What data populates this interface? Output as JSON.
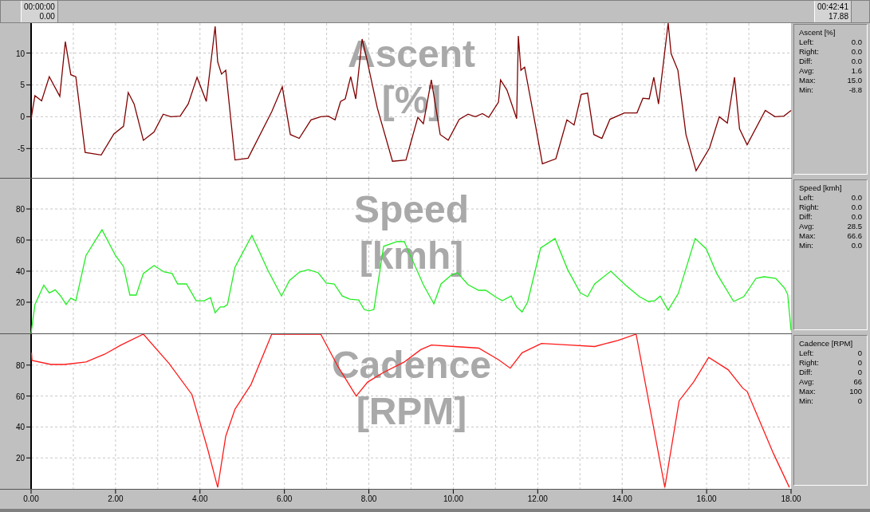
{
  "range_bar": {
    "start": {
      "time": "00:00:00",
      "distance": "0.00"
    },
    "end": {
      "time": "00:42:41",
      "distance": "17.88"
    }
  },
  "panels": [
    {
      "stats": {
        "title": "Ascent [%]",
        "rows": [
          {
            "label": "Left:",
            "value": "0.0"
          },
          {
            "label": "Right:",
            "value": "0.0"
          },
          {
            "label": "Diff:",
            "value": "0.0"
          },
          {
            "label": "Avg:",
            "value": "1.6"
          },
          {
            "label": "Max:",
            "value": "15.0"
          },
          {
            "label": "Min:",
            "value": "-8.8"
          }
        ]
      },
      "chart_data": {
        "type": "line",
        "grid": true,
        "title": "Ascent [%]",
        "xlim": [
          0,
          18
        ],
        "ylim": [
          -9.6,
          14.7
        ],
        "yticks": [
          -5,
          0,
          5,
          10
        ],
        "x": [
          0,
          0.09,
          0.25,
          0.43,
          0.68,
          0.81,
          0.94,
          1.06,
          1.28,
          1.66,
          1.96,
          2.19,
          2.3,
          2.44,
          2.66,
          2.91,
          3.13,
          3.31,
          3.53,
          3.72,
          3.93,
          4.15,
          4.36,
          4.42,
          4.51,
          4.61,
          4.83,
          5.14,
          5.7,
          5.95,
          6.14,
          6.35,
          6.63,
          6.86,
          7.04,
          7.2,
          7.33,
          7.44,
          7.57,
          7.69,
          7.84,
          7.95,
          8.2,
          8.56,
          8.88,
          9.16,
          9.29,
          9.48,
          9.69,
          9.88,
          10.14,
          10.35,
          10.52,
          10.69,
          10.84,
          11.07,
          11.12,
          11.27,
          11.5,
          11.54,
          11.6,
          11.69,
          11.95,
          12.11,
          12.43,
          12.69,
          12.86,
          13.03,
          13.18,
          13.33,
          13.52,
          13.71,
          14.05,
          14.35,
          14.49,
          14.64,
          14.75,
          14.86,
          15.09,
          15.16,
          15.32,
          15.51,
          15.75,
          16.07,
          16.3,
          16.49,
          16.66,
          16.78,
          16.96,
          17.39,
          17.62,
          17.83,
          18
        ],
        "series": [
          {
            "color": "#800000",
            "values": [
              -0.3,
              3.3,
              2.5,
              6.3,
              3.2,
              11.8,
              6.6,
              6.3,
              -5.6,
              -6,
              -2.7,
              -1.5,
              3.8,
              2,
              -3.7,
              -2.4,
              0.4,
              0,
              0.1,
              2,
              6.2,
              2.4,
              14.2,
              8.6,
              6.7,
              7.3,
              -6.8,
              -6.5,
              0.8,
              4.7,
              -2.8,
              -3.4,
              -0.5,
              0,
              0.1,
              -0.5,
              2.4,
              2.8,
              6.3,
              2.8,
              12.2,
              9.1,
              1.4,
              -7,
              -6.8,
              -0.1,
              -1.1,
              5.8,
              -2.8,
              -3.7,
              -0.4,
              0.4,
              0,
              0.5,
              -0.1,
              2.3,
              5.8,
              4.2,
              -0.3,
              12.7,
              7.3,
              7.8,
              -1.5,
              -7.4,
              -6.6,
              -0.5,
              -1.3,
              3.5,
              3.7,
              -2.8,
              -3.4,
              -0.4,
              0.6,
              0.6,
              2.9,
              2.8,
              6.2,
              2,
              14.7,
              9.9,
              7.3,
              -2.8,
              -8.5,
              -4.9,
              0,
              -1,
              6.2,
              -1.9,
              -4.4,
              1,
              0,
              0.1,
              1
            ]
          }
        ]
      }
    },
    {
      "stats": {
        "title": "Speed [kmh]",
        "rows": [
          {
            "label": "Left:",
            "value": "0.0"
          },
          {
            "label": "Right:",
            "value": "0.0"
          },
          {
            "label": "Diff:",
            "value": "0.0"
          },
          {
            "label": "Avg:",
            "value": "28.5"
          },
          {
            "label": "Max:",
            "value": "66.6"
          },
          {
            "label": "Min:",
            "value": "0.0"
          }
        ]
      },
      "chart_data": {
        "type": "line",
        "grid": true,
        "title": "Speed [kmh]",
        "xlim": [
          0,
          18
        ],
        "ylim": [
          0,
          99.5
        ],
        "yticks": [
          20,
          40,
          60,
          80
        ],
        "x": [
          0,
          0.09,
          0.3,
          0.43,
          0.57,
          0.7,
          0.83,
          0.94,
          1.06,
          1.3,
          1.68,
          2,
          2.19,
          2.34,
          2.49,
          2.66,
          2.91,
          3.15,
          3.34,
          3.47,
          3.68,
          3.91,
          4.1,
          4.25,
          4.36,
          4.48,
          4.57,
          4.65,
          4.83,
          5.23,
          5.61,
          5.93,
          6.12,
          6.36,
          6.57,
          6.8,
          6.99,
          7.18,
          7.37,
          7.55,
          7.76,
          7.89,
          8,
          8.12,
          8.35,
          8.67,
          8.84,
          9.29,
          9.54,
          9.71,
          9.95,
          10.1,
          10.35,
          10.6,
          10.77,
          11.03,
          11.16,
          11.37,
          11.5,
          11.63,
          11.76,
          12.07,
          12.41,
          12.71,
          13.01,
          13.18,
          13.35,
          13.73,
          14.09,
          14.41,
          14.62,
          14.77,
          14.9,
          15.09,
          15.33,
          15.73,
          15.99,
          16.24,
          16.64,
          16.88,
          17.17,
          17.36,
          17.64,
          17.85,
          17.92,
          18
        ],
        "series": [
          {
            "color": "#22ee22",
            "values": [
              0,
              18.5,
              31,
              26,
              28,
              24,
              18.5,
              22.6,
              21,
              50,
              66.6,
              50,
              43,
              24.6,
              24.6,
              38.5,
              43.6,
              39.5,
              38.5,
              31.8,
              31.8,
              21,
              21,
              23,
              13.3,
              17,
              17,
              18.5,
              42.6,
              63,
              40.5,
              24,
              34,
              39.5,
              41,
              39,
              32.3,
              31.8,
              24,
              22,
              21.5,
              15.4,
              14.4,
              15.4,
              56,
              59,
              59,
              31.3,
              19,
              31.8,
              37.4,
              39,
              31.3,
              27.7,
              27.7,
              23,
              21,
              24,
              17,
              13.8,
              20,
              54.9,
              61,
              41,
              26,
              23.6,
              31.8,
              40,
              30.8,
              23.6,
              20.5,
              21,
              24,
              14.9,
              25.6,
              61,
              54.4,
              38.5,
              20.5,
              23.6,
              35.4,
              36.4,
              35.4,
              29,
              25,
              2
            ]
          }
        ]
      }
    },
    {
      "stats": {
        "title": "Cadence [RPM]",
        "rows": [
          {
            "label": "Left:",
            "value": "0"
          },
          {
            "label": "Right:",
            "value": "0"
          },
          {
            "label": "Diff:",
            "value": "0"
          },
          {
            "label": "Avg:",
            "value": "66"
          },
          {
            "label": "Max:",
            "value": "100"
          },
          {
            "label": "Min:",
            "value": "0"
          }
        ]
      },
      "chart_data": {
        "type": "line",
        "grid": true,
        "title": "Cadence [RPM]",
        "xlim": [
          0,
          18
        ],
        "ylim": [
          0,
          100
        ],
        "yticks": [
          20,
          40,
          60,
          80
        ],
        "xticks": [
          {
            "value": 0,
            "label": "0.00"
          },
          {
            "value": 2,
            "label": "2.00"
          },
          {
            "value": 4,
            "label": "4.00"
          },
          {
            "value": 6,
            "label": "6.00"
          },
          {
            "value": 8,
            "label": "8.00"
          },
          {
            "value": 10,
            "label": "10.00"
          },
          {
            "value": 12,
            "label": "12.00"
          },
          {
            "value": 14,
            "label": "14.00"
          },
          {
            "value": 16,
            "label": "16.00"
          },
          {
            "value": 18,
            "label": "18.00"
          }
        ],
        "x": [
          0.01,
          0.02,
          0.47,
          0.79,
          1.3,
          1.74,
          2.13,
          2.66,
          3.27,
          3.81,
          4.19,
          4.42,
          4.61,
          4.83,
          5.21,
          5.7,
          6.86,
          7.27,
          7.7,
          7.97,
          8.33,
          8.84,
          9.23,
          9.48,
          10.03,
          10.6,
          11.07,
          11.35,
          11.63,
          12.09,
          12.75,
          13.35,
          13.9,
          14.33,
          15.01,
          15.35,
          15.69,
          16.05,
          16.51,
          16.86,
          16.96,
          17.58,
          17.96
        ],
        "series": [
          {
            "color": "#ff1a1a",
            "values": [
              88,
              83,
              80.4,
              80.4,
              82,
              87,
              93,
              100,
              81,
              61,
              25,
              1,
              34,
              51.5,
              67.5,
              100,
              100,
              79,
              60,
              69,
              75,
              82,
              90,
              93,
              92,
              91,
              83.5,
              78,
              88,
              94,
              93,
              92,
              96,
              100,
              1,
              57,
              69,
              85,
              77,
              65,
              63,
              23,
              1
            ]
          }
        ]
      }
    }
  ]
}
